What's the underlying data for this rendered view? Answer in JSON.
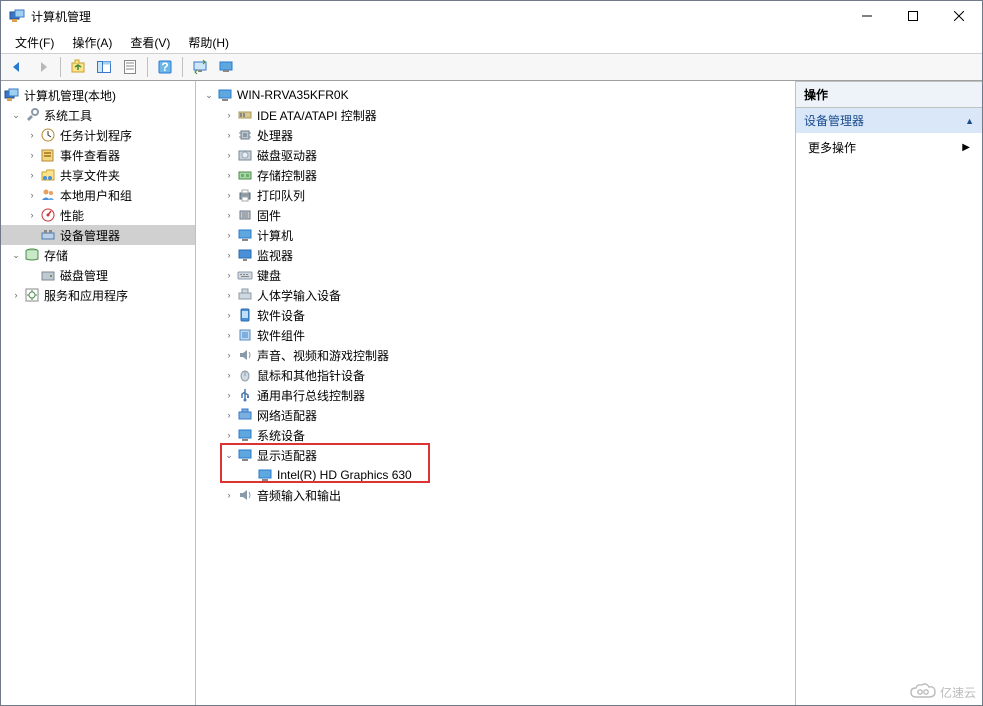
{
  "window": {
    "title": "计算机管理"
  },
  "menu": {
    "file": "文件(F)",
    "action": "操作(A)",
    "view": "查看(V)",
    "help": "帮助(H)"
  },
  "leftTree": {
    "root": "计算机管理(本地)",
    "systemTools": "系统工具",
    "taskScheduler": "任务计划程序",
    "eventViewer": "事件查看器",
    "sharedFolders": "共享文件夹",
    "localUsers": "本地用户和组",
    "performance": "性能",
    "deviceManager": "设备管理器",
    "storage": "存储",
    "diskManagement": "磁盘管理",
    "servicesApps": "服务和应用程序"
  },
  "devices": {
    "computer": "WIN-RRVA35KFR0K",
    "ideAta": "IDE ATA/ATAPI 控制器",
    "processor": "处理器",
    "diskDrive": "磁盘驱动器",
    "storageCtl": "存储控制器",
    "printQueue": "打印队列",
    "firmware": "固件",
    "computerCat": "计算机",
    "monitor": "监视器",
    "keyboard": "键盘",
    "hid": "人体学输入设备",
    "softwareDevice": "软件设备",
    "softwareComponent": "软件组件",
    "sound": "声音、视频和游戏控制器",
    "mouse": "鼠标和其他指针设备",
    "usb": "通用串行总线控制器",
    "network": "网络适配器",
    "systemDevice": "系统设备",
    "displayAdapter": "显示适配器",
    "gpu": "Intel(R) HD Graphics 630",
    "audioIO": "音频输入和输出"
  },
  "actions": {
    "header": "操作",
    "section": "设备管理器",
    "moreActions": "更多操作"
  },
  "watermark": "亿速云"
}
